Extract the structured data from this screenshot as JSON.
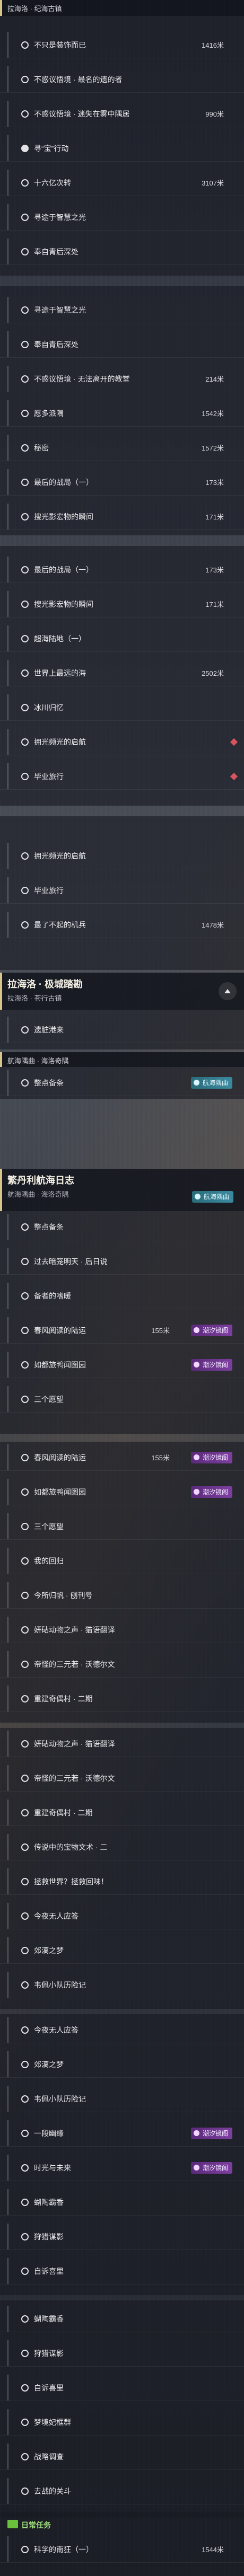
{
  "top_header": {
    "subtitle": "拉海洛 · 纪海古镇"
  },
  "section1_rows": [
    {
      "label": "不只是装饰而已",
      "dist": "1416米",
      "done": false
    },
    {
      "label": "不惑议悟境 · 最名的遗的者",
      "dist": "",
      "done": false
    },
    {
      "label": "不惑议悟境 · 迷失在雾中隅居",
      "dist": "990米",
      "done": false
    },
    {
      "label": "寻“宝”行动",
      "dist": "",
      "done": true
    },
    {
      "label": "十六亿次转",
      "dist": "3107米",
      "done": false
    },
    {
      "label": "寻途于智慧之光",
      "dist": "",
      "done": false
    },
    {
      "label": "奉自青后深处",
      "dist": "",
      "done": false
    }
  ],
  "section1b_rows": [
    {
      "label": "寻途于智慧之光",
      "dist": "",
      "done": false
    },
    {
      "label": "奉自青后深处",
      "dist": "",
      "done": false
    },
    {
      "label": "不惑议悟境 · 无法离开的教堂",
      "dist": "214米",
      "done": false
    },
    {
      "label": "愿多派隅",
      "dist": "1542米",
      "done": false
    },
    {
      "label": "秘密",
      "dist": "1572米",
      "done": false
    },
    {
      "label": "最后的战局（一）",
      "dist": "173米",
      "done": false
    },
    {
      "label": "搜光影宏物的瞬间",
      "dist": "171米",
      "done": false
    }
  ],
  "section1c_rows": [
    {
      "label": "最后的战局（一）",
      "dist": "173米",
      "done": false
    },
    {
      "label": "搜光影宏物的瞬间",
      "dist": "171米",
      "done": false
    },
    {
      "label": "超海陆地（一）",
      "dist": "",
      "done": false
    },
    {
      "label": "世界上最远的海",
      "dist": "2502米",
      "done": false
    },
    {
      "label": "冰川归忆",
      "dist": "",
      "done": false
    },
    {
      "label": "拥光频光的启航",
      "dist": "",
      "diamond": true,
      "done": false
    },
    {
      "label": "毕业旅行",
      "dist": "",
      "diamond": true,
      "done": false
    }
  ],
  "section1d_rows": [
    {
      "label": "拥光频光的启航",
      "dist": "",
      "done": false
    },
    {
      "label": "毕业旅行",
      "dist": "",
      "done": false
    },
    {
      "label": "最了不起的机兵",
      "dist": "1478米",
      "done": false
    }
  ],
  "header2": {
    "title": "拉海洛 · 极城踏勘",
    "subtitle": "拉海洛 · 苍行古镇"
  },
  "section2_rows": [
    {
      "label": "遗脏港来",
      "dist": "",
      "done": false
    }
  ],
  "small_header": {
    "subtitle": "航海隅曲 · 海洛奇隅"
  },
  "section2b_rows": [
    {
      "label": "整点备条",
      "dist": "",
      "done": false,
      "badge": "航海隅曲",
      "badge_style": "teal"
    }
  ],
  "header3": {
    "title": "繁丹利航海日志",
    "subtitle": "航海隅曲 · 海洛奇隅",
    "badge": "航海隅曲"
  },
  "section3_rows": [
    {
      "label": "整点备条",
      "dist": "",
      "done": false
    },
    {
      "label": "过去暗笼明天 · 后日说",
      "dist": "",
      "done": false
    },
    {
      "label": "备者的嗜暖",
      "dist": "",
      "done": false
    },
    {
      "label": "春风阅读的陆运",
      "dist": "155米",
      "done": false,
      "badge": "潮汐镜阁"
    },
    {
      "label": "如都旅鸭闻图园",
      "dist": "",
      "done": false,
      "badge": "潮汐镜阁"
    },
    {
      "label": "三个愿望",
      "dist": "",
      "done": false
    }
  ],
  "section3b_rows": [
    {
      "label": "春风阅读的陆运",
      "dist": "155米",
      "done": false,
      "badge": "潮汐镜阁"
    },
    {
      "label": "如都旅鸭闻图园",
      "dist": "",
      "done": false,
      "badge": "潮汐镜阁"
    },
    {
      "label": "三个愿望",
      "dist": "",
      "done": false
    },
    {
      "label": "我的回归",
      "dist": "",
      "done": false
    },
    {
      "label": "今所归帆 · 刨刊号",
      "dist": "",
      "done": false
    },
    {
      "label": "妍砧动物之声 · 猫语翻译",
      "dist": "",
      "done": false
    },
    {
      "label": "帝怪的三元若 · 沃德尔文",
      "dist": "",
      "done": false
    },
    {
      "label": "重建奇偶村 · 二期",
      "dist": "",
      "done": false
    }
  ],
  "section3c_rows": [
    {
      "label": "妍砧动物之声 · 猫语翻译",
      "dist": "",
      "done": false
    },
    {
      "label": "帝怪的三元若 · 沃德尔文",
      "dist": "",
      "done": false
    },
    {
      "label": "重建奇偶村 · 二期",
      "dist": "",
      "done": false
    },
    {
      "label": "传说中的宝物文术 · 二",
      "dist": "",
      "done": false
    },
    {
      "label": "拯救世界？拯救回味！",
      "dist": "",
      "done": false
    },
    {
      "label": "今夜无人应答",
      "dist": "",
      "done": false
    },
    {
      "label": "郊漓之梦",
      "dist": "",
      "done": false
    },
    {
      "label": "韦佩小队历险记",
      "dist": "",
      "done": false
    }
  ],
  "section3d_rows": [
    {
      "label": "今夜无人应答",
      "dist": "",
      "done": false
    },
    {
      "label": "郊漓之梦",
      "dist": "",
      "done": false
    },
    {
      "label": "韦佩小队历险记",
      "dist": "",
      "done": false
    },
    {
      "label": "一段幽缘",
      "dist": "",
      "done": false,
      "badge": "潮汐镜阁"
    },
    {
      "label": "时光与未来",
      "dist": "",
      "done": false,
      "badge": "潮汐镜阁"
    },
    {
      "label": "蝴陶霸香",
      "dist": "",
      "done": false
    },
    {
      "label": "狩猎谋影",
      "dist": "",
      "done": false
    },
    {
      "label": "自诉喜里",
      "dist": "",
      "done": false
    }
  ],
  "section3e_rows": [
    {
      "label": "蝴陶霸香",
      "dist": "",
      "done": false
    },
    {
      "label": "狩猎谋影",
      "dist": "",
      "done": false
    },
    {
      "label": "自诉喜里",
      "dist": "",
      "done": false
    },
    {
      "label": "梦境妃框群",
      "dist": "",
      "done": false
    },
    {
      "label": "战略调查",
      "dist": "",
      "done": false
    },
    {
      "label": "去战的关斗",
      "dist": "",
      "done": false
    }
  ],
  "footer": {
    "title": "日常任务",
    "row_label": "科学的南狂（一）",
    "row_dist": "1544米"
  }
}
